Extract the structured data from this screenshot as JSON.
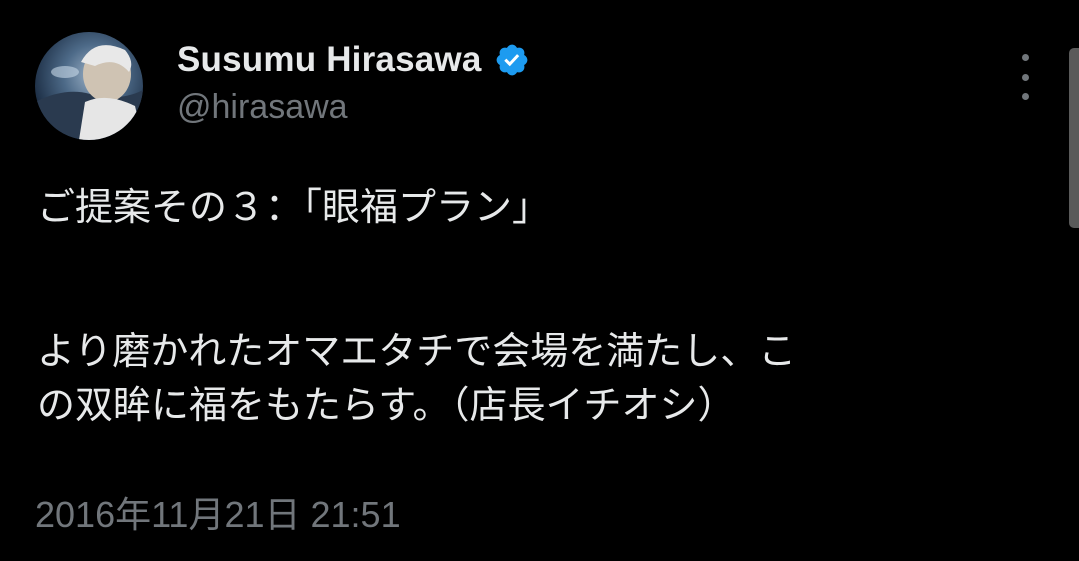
{
  "author": {
    "display_name": "Susumu Hirasawa",
    "handle": "@hirasawa",
    "verified_icon": "verified-badge-icon",
    "verified_color": "#1d9bf0"
  },
  "tweet": {
    "line1": "ご提案その３：「眼福プラン」",
    "line2": "より磨かれたオマエタチで会場を満たし、こ",
    "line3": "の双眸に福をもたらす。（店長イチオシ）"
  },
  "meta": {
    "timestamp": "2016年11月21日 21:51"
  },
  "icons": {
    "more": "more-options-icon"
  },
  "colors": {
    "background": "#000000",
    "text": "#e7e9ea",
    "secondary": "#71767b"
  }
}
